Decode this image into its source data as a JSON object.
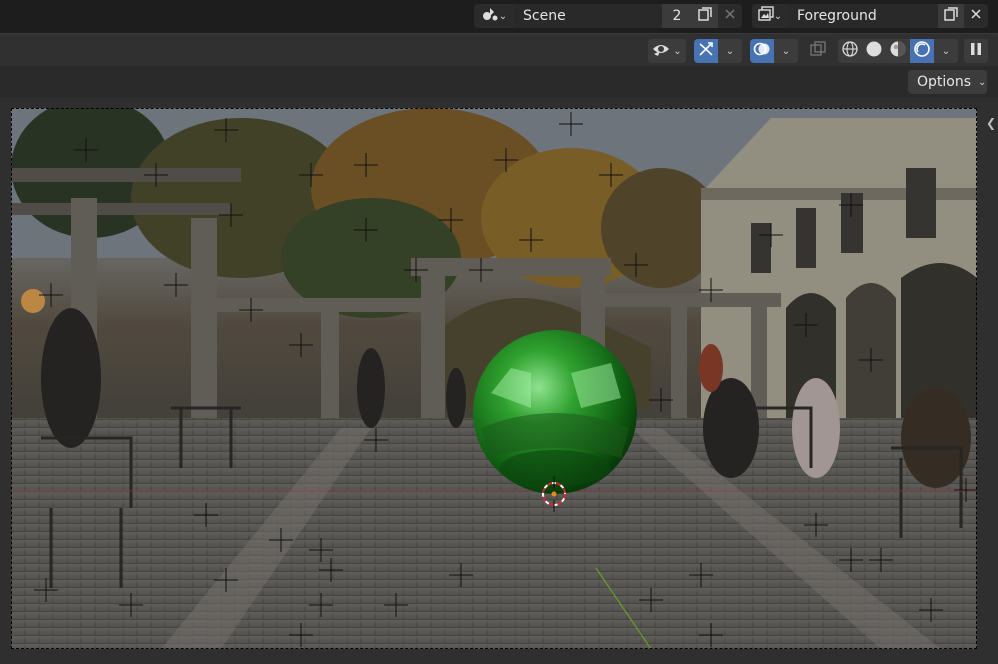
{
  "scene": {
    "label": "Scene",
    "users": "2"
  },
  "view_layer": {
    "label": "Foreground"
  },
  "header": {
    "options_label": "Options"
  },
  "icons": {
    "scene_type": "scene-icon",
    "duplicate": "duplicate-icon",
    "close": "close-icon",
    "view_layer": "view-layer-icon",
    "visibility": "eye-icon",
    "gizmo": "gizmo-icon",
    "overlay": "overlay-icon",
    "xray": "xray-icon",
    "wireframe": "wireframe-shading-icon",
    "solid": "solid-shading-icon",
    "material": "material-shading-icon",
    "rendered": "rendered-shading-icon",
    "pause": "pause-icon",
    "sidebar_toggle": "chevron-left-icon"
  },
  "colors": {
    "accent": "#4772b3",
    "topbar": "#1d1d1d",
    "header": "#303030",
    "sphere": "#2a9a2a"
  }
}
